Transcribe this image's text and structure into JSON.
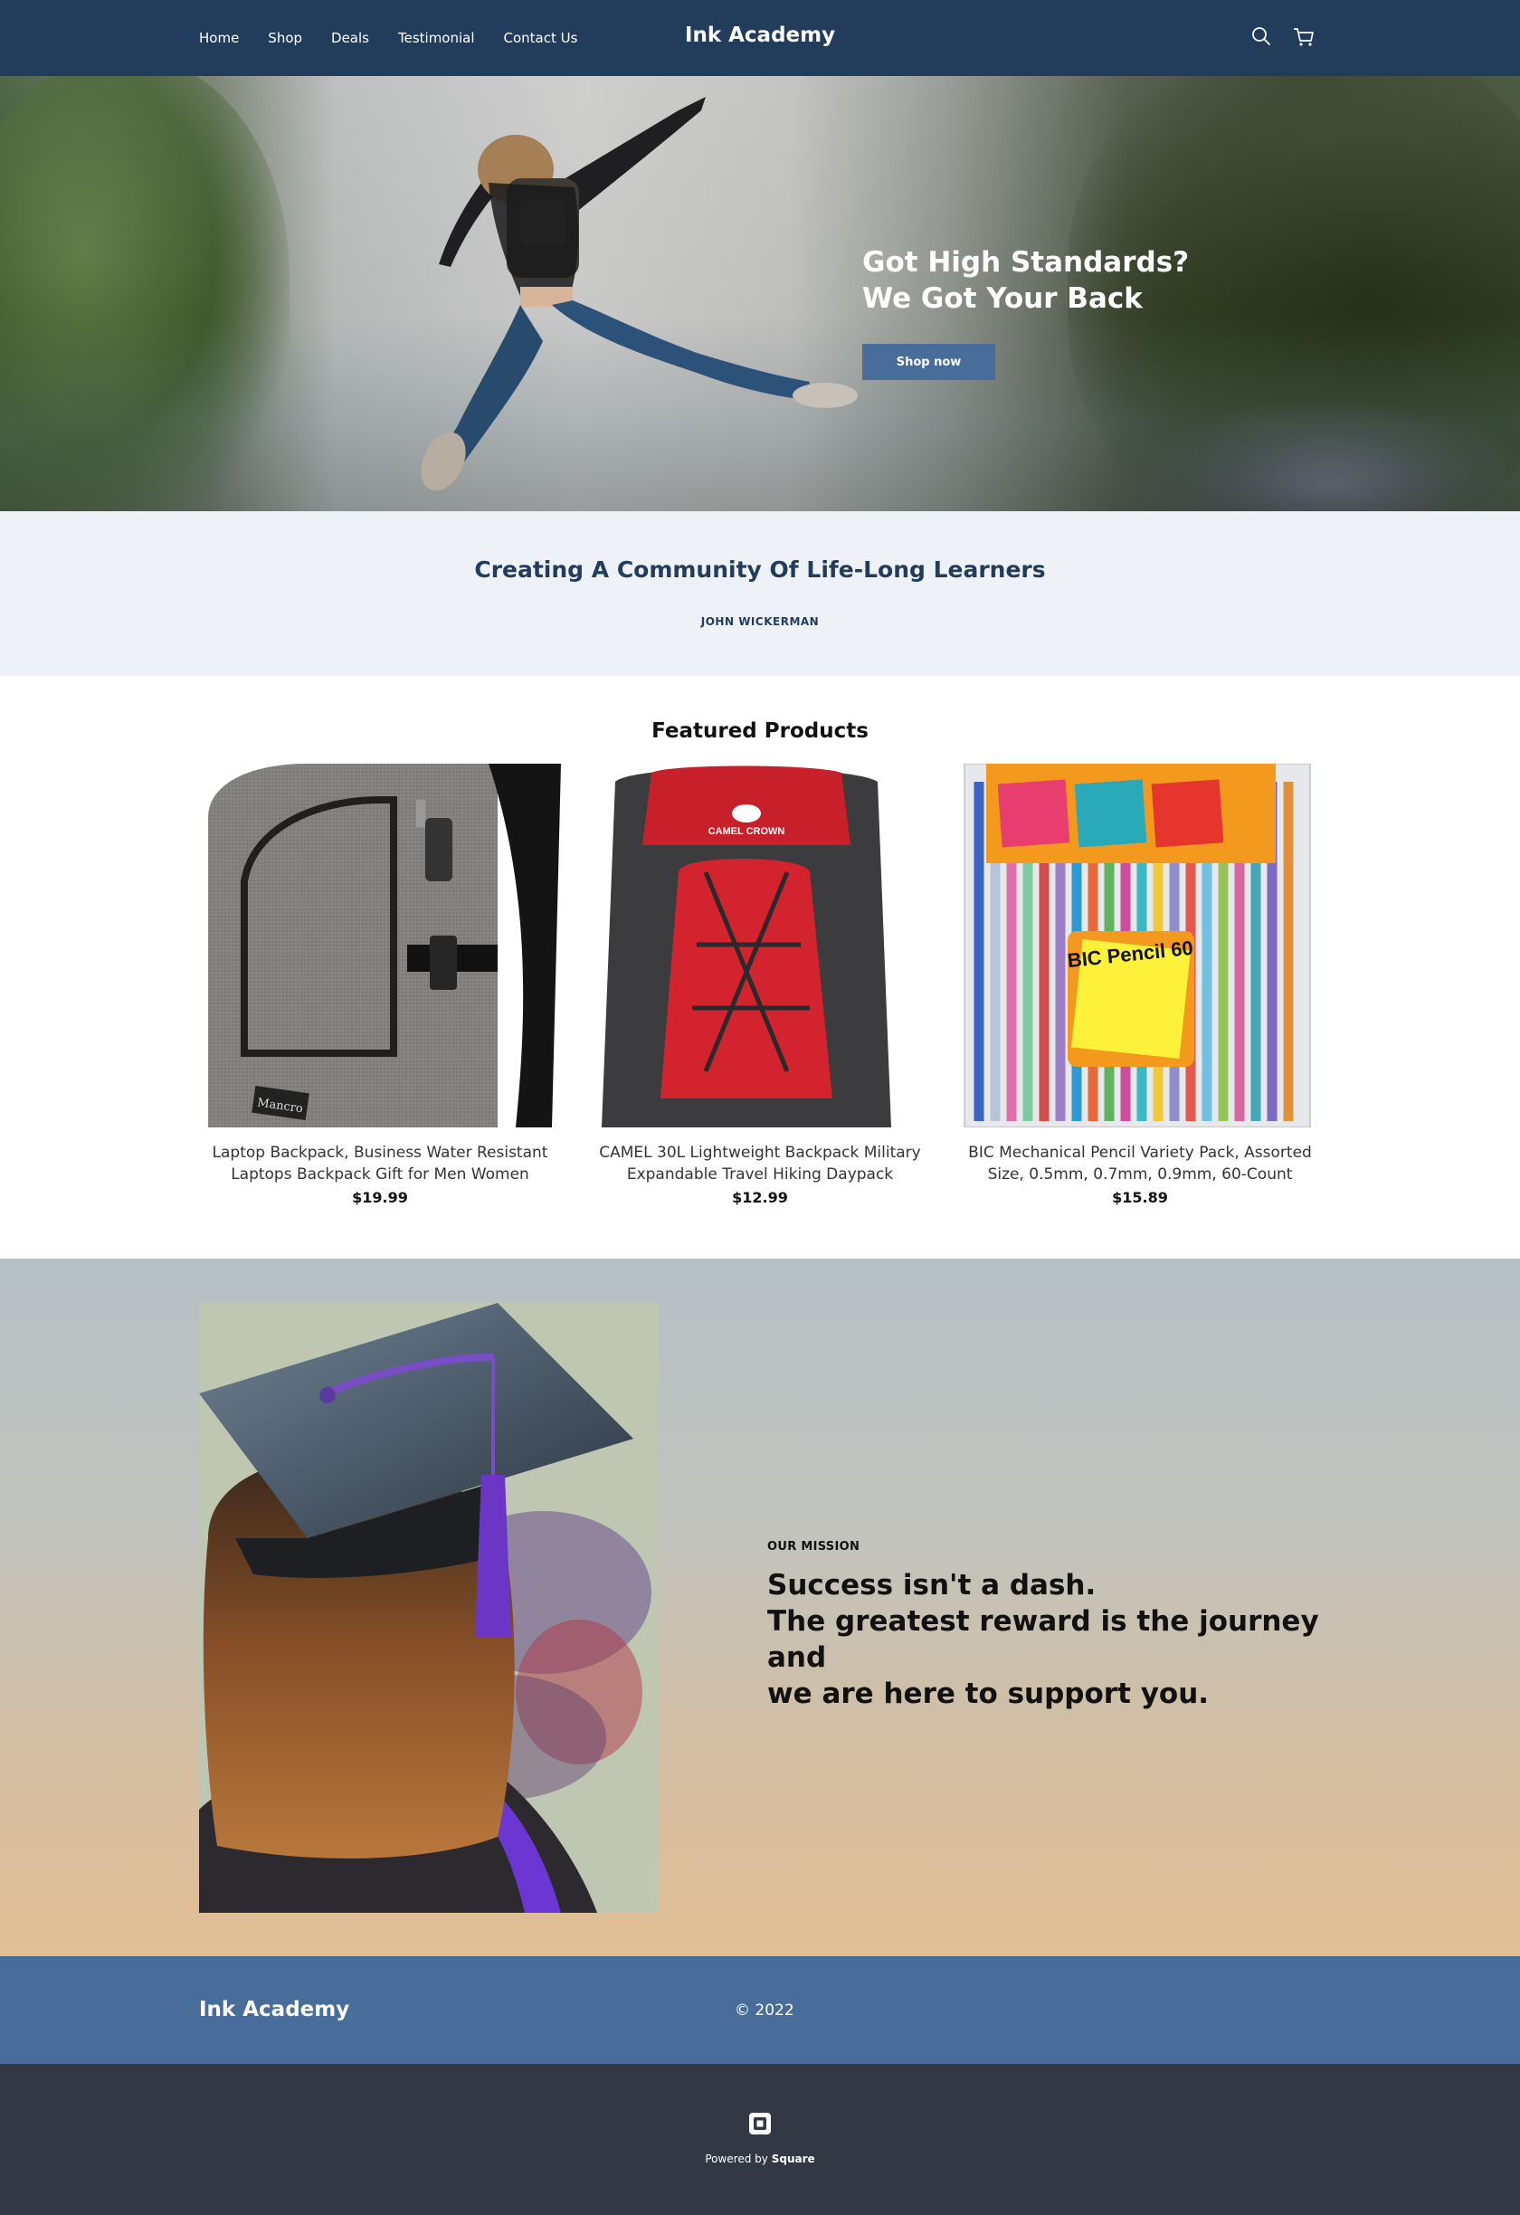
{
  "header": {
    "nav": [
      "Home",
      "Shop",
      "Deals",
      "Testimonial",
      "Contact Us"
    ],
    "brand": "Ink Academy",
    "icons": [
      "search-icon",
      "cart-icon"
    ]
  },
  "hero": {
    "title_line1": "Got High Standards?",
    "title_line2": "We Got Your Back",
    "button": "Shop now"
  },
  "community": {
    "heading": "Creating A Community Of Life-Long Learners",
    "author": "JOHN WICKERMAN"
  },
  "featured": {
    "title": "Featured Products",
    "products": [
      {
        "name": "Laptop Backpack, Business Water Resistant Laptops Backpack Gift for Men Women",
        "price": "$19.99",
        "image_text": "Mancro"
      },
      {
        "name": "CAMEL 30L Lightweight Backpack Military Expandable Travel Hiking Daypack",
        "price": "$12.99",
        "image_text": "CAMEL CROWN"
      },
      {
        "name": "BIC Mechanical Pencil Variety Pack, Assorted Size, 0.5mm, 0.7mm, 0.9mm, 60-Count",
        "price": "$15.89",
        "image_text": "BIC Pencil 60"
      }
    ]
  },
  "mission": {
    "label": "OUR MISSION",
    "line1": "Success isn't a dash.",
    "line2": "The greatest reward is the journey and",
    "line3": "we are here to support you."
  },
  "footer": {
    "brand": "Ink Academy",
    "copyright": "© 2022",
    "powered_prefix": "Powered by",
    "powered_brand": "Square"
  },
  "colors": {
    "header_bg": "#223d5c",
    "accent": "#486d9b",
    "community_bg": "#eef1f5",
    "powered_bg": "#323844"
  }
}
